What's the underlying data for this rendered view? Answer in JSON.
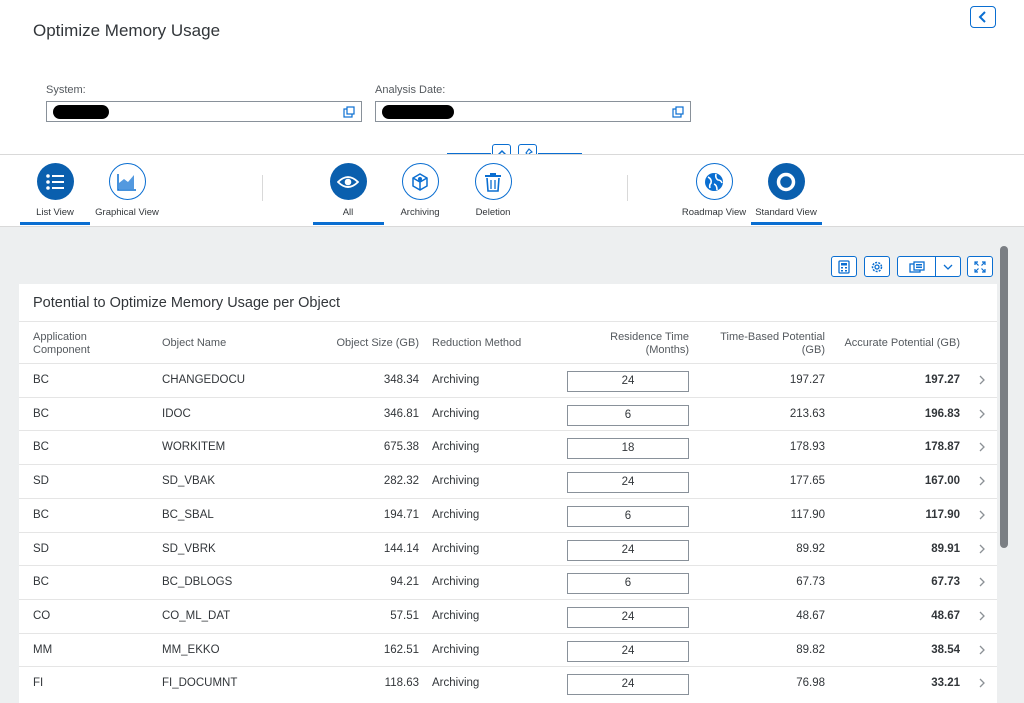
{
  "header": {
    "title": "Optimize Memory Usage"
  },
  "filters": {
    "system_label": "System:",
    "analysis_date_label": "Analysis Date:"
  },
  "toolbar": {
    "list_view": "List View",
    "graphical_view": "Graphical View",
    "all": "All",
    "archiving": "Archiving",
    "deletion": "Deletion",
    "roadmap_view": "Roadmap View",
    "standard_view": "Standard View"
  },
  "table": {
    "title": "Potential to Optimize Memory Usage per Object",
    "columns": {
      "app_component": "Application Component",
      "object_name": "Object Name",
      "object_size": "Object Size (GB)",
      "reduction_method": "Reduction Method",
      "residence_time": "Residence Time (Months)",
      "time_based": "Time-Based Potential (GB)",
      "accurate": "Accurate Potential (GB)"
    },
    "rows": [
      {
        "component": "BC",
        "object": "CHANGEDOCU",
        "size": "348.34",
        "method": "Archiving",
        "residence": "24",
        "time_based": "197.27",
        "accurate": "197.27"
      },
      {
        "component": "BC",
        "object": "IDOC",
        "size": "346.81",
        "method": "Archiving",
        "residence": "6",
        "time_based": "213.63",
        "accurate": "196.83"
      },
      {
        "component": "BC",
        "object": "WORKITEM",
        "size": "675.38",
        "method": "Archiving",
        "residence": "18",
        "time_based": "178.93",
        "accurate": "178.87"
      },
      {
        "component": "SD",
        "object": "SD_VBAK",
        "size": "282.32",
        "method": "Archiving",
        "residence": "24",
        "time_based": "177.65",
        "accurate": "167.00"
      },
      {
        "component": "BC",
        "object": "BC_SBAL",
        "size": "194.71",
        "method": "Archiving",
        "residence": "6",
        "time_based": "117.90",
        "accurate": "117.90"
      },
      {
        "component": "SD",
        "object": "SD_VBRK",
        "size": "144.14",
        "method": "Archiving",
        "residence": "24",
        "time_based": "89.92",
        "accurate": "89.91"
      },
      {
        "component": "BC",
        "object": "BC_DBLOGS",
        "size": "94.21",
        "method": "Archiving",
        "residence": "6",
        "time_based": "67.73",
        "accurate": "67.73"
      },
      {
        "component": "CO",
        "object": "CO_ML_DAT",
        "size": "57.51",
        "method": "Archiving",
        "residence": "24",
        "time_based": "48.67",
        "accurate": "48.67"
      },
      {
        "component": "MM",
        "object": "MM_EKKO",
        "size": "162.51",
        "method": "Archiving",
        "residence": "24",
        "time_based": "89.82",
        "accurate": "38.54"
      },
      {
        "component": "FI",
        "object": "FI_DOCUMNT",
        "size": "118.63",
        "method": "Archiving",
        "residence": "24",
        "time_based": "76.98",
        "accurate": "33.21"
      }
    ]
  },
  "colors": {
    "accent": "#0a6ed1",
    "icon_fill": "#0a5fae"
  }
}
